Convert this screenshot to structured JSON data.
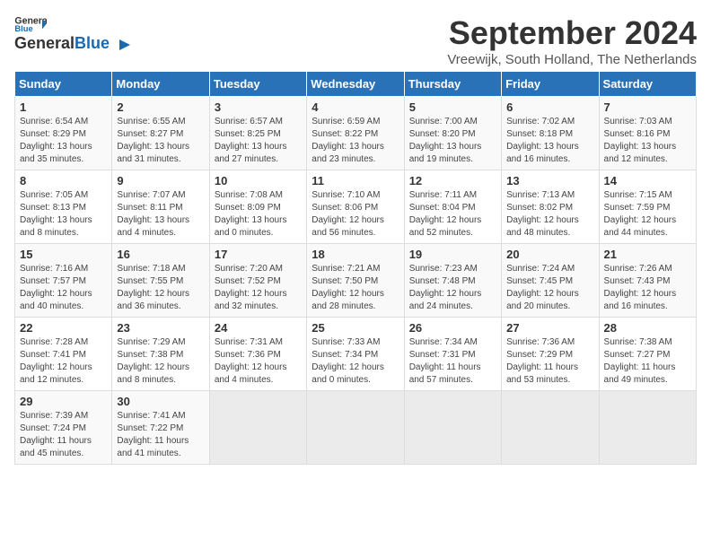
{
  "header": {
    "logo_line1": "General",
    "logo_line2": "Blue",
    "month_title": "September 2024",
    "location": "Vreewijk, South Holland, The Netherlands"
  },
  "weekdays": [
    "Sunday",
    "Monday",
    "Tuesday",
    "Wednesday",
    "Thursday",
    "Friday",
    "Saturday"
  ],
  "weeks": [
    [
      {
        "day": "1",
        "info": "Sunrise: 6:54 AM\nSunset: 8:29 PM\nDaylight: 13 hours\nand 35 minutes."
      },
      {
        "day": "2",
        "info": "Sunrise: 6:55 AM\nSunset: 8:27 PM\nDaylight: 13 hours\nand 31 minutes."
      },
      {
        "day": "3",
        "info": "Sunrise: 6:57 AM\nSunset: 8:25 PM\nDaylight: 13 hours\nand 27 minutes."
      },
      {
        "day": "4",
        "info": "Sunrise: 6:59 AM\nSunset: 8:22 PM\nDaylight: 13 hours\nand 23 minutes."
      },
      {
        "day": "5",
        "info": "Sunrise: 7:00 AM\nSunset: 8:20 PM\nDaylight: 13 hours\nand 19 minutes."
      },
      {
        "day": "6",
        "info": "Sunrise: 7:02 AM\nSunset: 8:18 PM\nDaylight: 13 hours\nand 16 minutes."
      },
      {
        "day": "7",
        "info": "Sunrise: 7:03 AM\nSunset: 8:16 PM\nDaylight: 13 hours\nand 12 minutes."
      }
    ],
    [
      {
        "day": "8",
        "info": "Sunrise: 7:05 AM\nSunset: 8:13 PM\nDaylight: 13 hours\nand 8 minutes."
      },
      {
        "day": "9",
        "info": "Sunrise: 7:07 AM\nSunset: 8:11 PM\nDaylight: 13 hours\nand 4 minutes."
      },
      {
        "day": "10",
        "info": "Sunrise: 7:08 AM\nSunset: 8:09 PM\nDaylight: 13 hours\nand 0 minutes."
      },
      {
        "day": "11",
        "info": "Sunrise: 7:10 AM\nSunset: 8:06 PM\nDaylight: 12 hours\nand 56 minutes."
      },
      {
        "day": "12",
        "info": "Sunrise: 7:11 AM\nSunset: 8:04 PM\nDaylight: 12 hours\nand 52 minutes."
      },
      {
        "day": "13",
        "info": "Sunrise: 7:13 AM\nSunset: 8:02 PM\nDaylight: 12 hours\nand 48 minutes."
      },
      {
        "day": "14",
        "info": "Sunrise: 7:15 AM\nSunset: 7:59 PM\nDaylight: 12 hours\nand 44 minutes."
      }
    ],
    [
      {
        "day": "15",
        "info": "Sunrise: 7:16 AM\nSunset: 7:57 PM\nDaylight: 12 hours\nand 40 minutes."
      },
      {
        "day": "16",
        "info": "Sunrise: 7:18 AM\nSunset: 7:55 PM\nDaylight: 12 hours\nand 36 minutes."
      },
      {
        "day": "17",
        "info": "Sunrise: 7:20 AM\nSunset: 7:52 PM\nDaylight: 12 hours\nand 32 minutes."
      },
      {
        "day": "18",
        "info": "Sunrise: 7:21 AM\nSunset: 7:50 PM\nDaylight: 12 hours\nand 28 minutes."
      },
      {
        "day": "19",
        "info": "Sunrise: 7:23 AM\nSunset: 7:48 PM\nDaylight: 12 hours\nand 24 minutes."
      },
      {
        "day": "20",
        "info": "Sunrise: 7:24 AM\nSunset: 7:45 PM\nDaylight: 12 hours\nand 20 minutes."
      },
      {
        "day": "21",
        "info": "Sunrise: 7:26 AM\nSunset: 7:43 PM\nDaylight: 12 hours\nand 16 minutes."
      }
    ],
    [
      {
        "day": "22",
        "info": "Sunrise: 7:28 AM\nSunset: 7:41 PM\nDaylight: 12 hours\nand 12 minutes."
      },
      {
        "day": "23",
        "info": "Sunrise: 7:29 AM\nSunset: 7:38 PM\nDaylight: 12 hours\nand 8 minutes."
      },
      {
        "day": "24",
        "info": "Sunrise: 7:31 AM\nSunset: 7:36 PM\nDaylight: 12 hours\nand 4 minutes."
      },
      {
        "day": "25",
        "info": "Sunrise: 7:33 AM\nSunset: 7:34 PM\nDaylight: 12 hours\nand 0 minutes."
      },
      {
        "day": "26",
        "info": "Sunrise: 7:34 AM\nSunset: 7:31 PM\nDaylight: 11 hours\nand 57 minutes."
      },
      {
        "day": "27",
        "info": "Sunrise: 7:36 AM\nSunset: 7:29 PM\nDaylight: 11 hours\nand 53 minutes."
      },
      {
        "day": "28",
        "info": "Sunrise: 7:38 AM\nSunset: 7:27 PM\nDaylight: 11 hours\nand 49 minutes."
      }
    ],
    [
      {
        "day": "29",
        "info": "Sunrise: 7:39 AM\nSunset: 7:24 PM\nDaylight: 11 hours\nand 45 minutes."
      },
      {
        "day": "30",
        "info": "Sunrise: 7:41 AM\nSunset: 7:22 PM\nDaylight: 11 hours\nand 41 minutes."
      },
      {
        "day": "",
        "info": ""
      },
      {
        "day": "",
        "info": ""
      },
      {
        "day": "",
        "info": ""
      },
      {
        "day": "",
        "info": ""
      },
      {
        "day": "",
        "info": ""
      }
    ]
  ]
}
